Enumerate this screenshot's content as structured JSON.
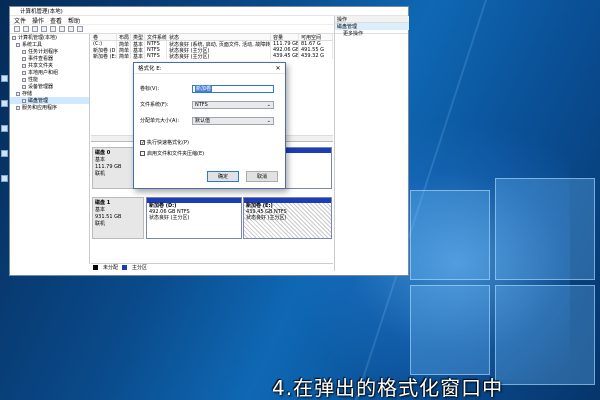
{
  "window": {
    "title": "计算机管理(本地)",
    "menu": [
      "文件",
      "操作",
      "查看",
      "帮助"
    ]
  },
  "tree": [
    {
      "label": "计算机管理(本地)",
      "indent": 0
    },
    {
      "label": "系统工具",
      "indent": 1
    },
    {
      "label": "任务计划程序",
      "indent": 2
    },
    {
      "label": "事件查看器",
      "indent": 2
    },
    {
      "label": "共享文件夹",
      "indent": 2
    },
    {
      "label": "本地用户和组",
      "indent": 2
    },
    {
      "label": "性能",
      "indent": 2
    },
    {
      "label": "设备管理器",
      "indent": 2
    },
    {
      "label": "存储",
      "indent": 1
    },
    {
      "label": "磁盘管理",
      "indent": 2,
      "selected": true
    },
    {
      "label": "服务和应用程序",
      "indent": 1
    }
  ],
  "volume_table": {
    "headers": [
      "卷",
      "布局",
      "类型",
      "文件系统",
      "状态",
      "容量",
      "可用空间"
    ],
    "rows": [
      [
        "(C:)",
        "简单",
        "基本",
        "NTFS",
        "状态良好 (系统, 启动, 页面文件, 活动, 故障转储, 主分区)",
        "111.79 GB",
        "81.67 G"
      ],
      [
        "新加卷 (D:)",
        "简单",
        "基本",
        "NTFS",
        "状态良好 (主分区)",
        "492.06 GB",
        "491.55 G"
      ],
      [
        "新加卷 (E:)",
        "简单",
        "基本",
        "NTFS",
        "状态良好 (主分区)",
        "439.45 GB",
        "439.32 G"
      ]
    ]
  },
  "disks": [
    {
      "name": "磁盘 0",
      "type": "基本",
      "size": "111.79 GB",
      "status": "联机"
    },
    {
      "name": "磁盘 1",
      "type": "基本",
      "size": "931.51 GB",
      "status": "联机"
    }
  ],
  "disk1_partitions": [
    {
      "label": "新加卷 (D:)",
      "size": "492.06 GB NTFS",
      "status": "状态良好 (主分区)"
    },
    {
      "label": "新加卷 (E:)",
      "size": "439.45 GB NTFS",
      "status": "状态良好 (主分区)"
    }
  ],
  "legend": [
    {
      "label": "未分配",
      "color": "#000000"
    },
    {
      "label": "主分区",
      "color": "#1d3db4"
    }
  ],
  "actions": {
    "header": "操作",
    "section": "磁盘管理",
    "item": "更多操作"
  },
  "format_dialog": {
    "title": "格式化 E:",
    "volume_label": "卷标(V):",
    "volume_value": "新加卷",
    "fs_label": "文件系统(F):",
    "fs_value": "NTFS",
    "alloc_label": "分配单元大小(A):",
    "alloc_value": "默认值",
    "quick_format": "执行快速格式化(P)",
    "compression": "启用文件和文件夹压缩(E)",
    "ok": "确定",
    "cancel": "取消"
  },
  "caption": "4.在弹出的格式化窗口中"
}
